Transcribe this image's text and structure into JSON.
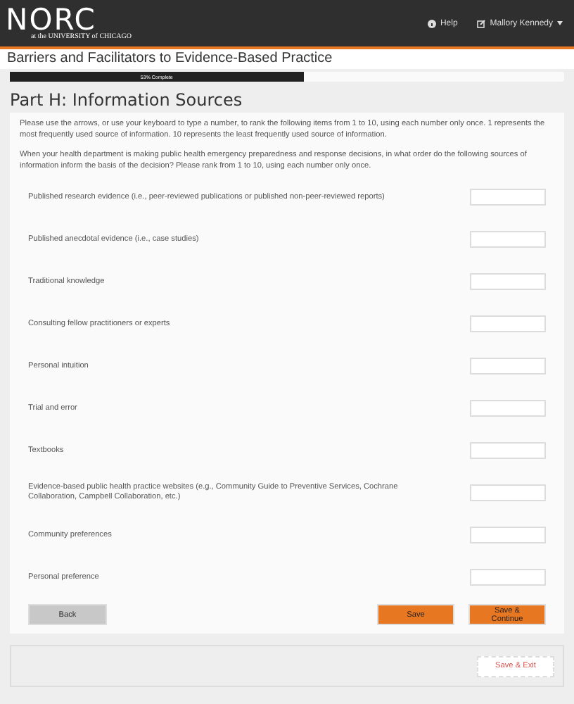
{
  "header": {
    "logo": "NORC",
    "logo_sub": "at the UNIVERSITY of CHICAGO",
    "help": "Help",
    "user": "Mallory Kennedy"
  },
  "survey_title": "Barriers and Facilitators to Evidence-Based Practice",
  "progress": {
    "label": "53% Complete",
    "level": 0.53
  },
  "section_title": "Part H: Information Sources",
  "instructions": [
    "Please use the arrows, or use your keyboard to type a number, to rank the following items from 1 to 10, using each number only once. 1 represents the most frequently used source of information. 10 represents the least frequently used source of information.",
    "When your health department is making public health emergency preparedness and response decisions, in what order do the following sources of information inform the basis of the decision? Please rank from 1 to 10, using each number only once."
  ],
  "items": [
    {
      "label": "Published research evidence (i.e., peer-reviewed publications or published non-peer-reviewed reports)"
    },
    {
      "label": "Published anecdotal evidence (i.e., case studies)"
    },
    {
      "label": "Traditional knowledge"
    },
    {
      "label": "Consulting fellow practitioners or experts"
    },
    {
      "label": "Personal intuition"
    },
    {
      "label": "Trial and error"
    },
    {
      "label": "Textbooks"
    },
    {
      "label": "Evidence-based public health practice websites (e.g., Community Guide to Preventive Services, Cochrane Collaboration, Campbell Collaboration, etc.)"
    },
    {
      "label": "Community preferences"
    },
    {
      "label": "Personal preference"
    }
  ],
  "buttons": {
    "back": "Back",
    "save": "Save",
    "save_continue": "Save & Continue",
    "save_exit": "Save & Exit"
  }
}
